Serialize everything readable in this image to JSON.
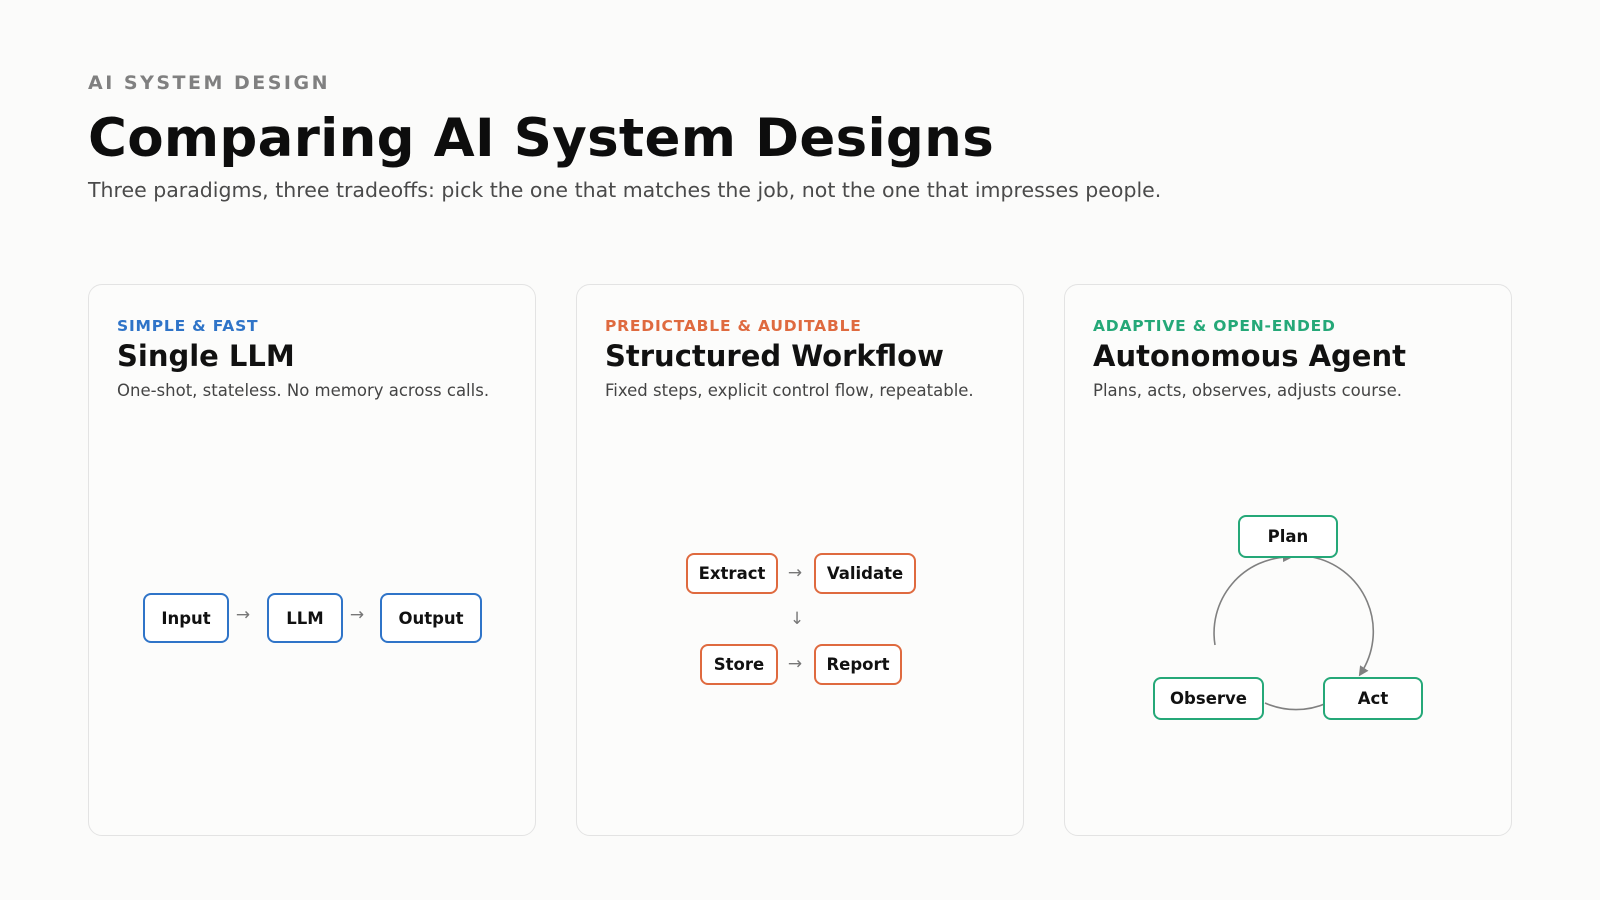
{
  "header": {
    "eyebrow": "AI SYSTEM DESIGN",
    "title": "Comparing AI System Designs",
    "subtitle": "Three paradigms, three tradeoffs: pick the one that matches the job, not the one that impresses people."
  },
  "colors": {
    "single": "#2f74c8",
    "workflow": "#df6a3f",
    "agent": "#25a878"
  },
  "cards": [
    {
      "tag": "SIMPLE & FAST",
      "title": "Single LLM",
      "description": "One-shot, stateless. No memory across calls.",
      "nodes": [
        "Input",
        "LLM",
        "Output"
      ],
      "arrows": [
        "→",
        "→"
      ]
    },
    {
      "tag": "PREDICTABLE & AUDITABLE",
      "title": "Structured Workflow",
      "description": "Fixed steps, explicit control flow, repeatable.",
      "nodes": [
        "Extract",
        "Validate",
        "Store",
        "Report"
      ],
      "arrows": [
        "→",
        "↓",
        "→"
      ]
    },
    {
      "tag": "ADAPTIVE & OPEN-ENDED",
      "title": "Autonomous Agent",
      "description": "Plans, acts, observes, adjusts course.",
      "nodes": [
        "Plan",
        "Act",
        "Observe"
      ]
    }
  ]
}
